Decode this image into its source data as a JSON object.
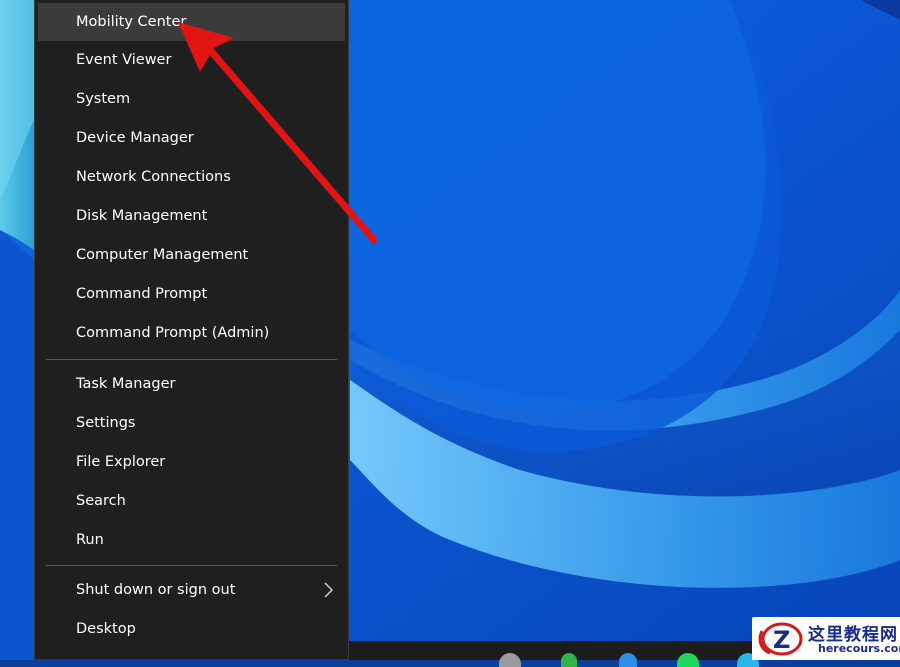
{
  "colors": {
    "menu_bg": "#1f1f1f",
    "menu_highlight": "#3b3b3b",
    "menu_text": "#ffffff",
    "separator": "#5a5a5a",
    "arrow": "#e11414",
    "desktop_blue": "#0a57d8"
  },
  "context_menu": {
    "group1": [
      {
        "label": "Mobility Center",
        "highlighted": true
      },
      {
        "label": "Event Viewer"
      },
      {
        "label": "System"
      },
      {
        "label": "Device Manager"
      },
      {
        "label": "Network Connections"
      },
      {
        "label": "Disk Management"
      },
      {
        "label": "Computer Management"
      },
      {
        "label": "Command Prompt"
      },
      {
        "label": "Command Prompt (Admin)"
      }
    ],
    "group2": [
      {
        "label": "Task Manager"
      },
      {
        "label": "Settings"
      },
      {
        "label": "File Explorer"
      },
      {
        "label": "Search"
      },
      {
        "label": "Run"
      }
    ],
    "group3": [
      {
        "label": "Shut down or sign out",
        "submenu_icon": "chevron-right-icon"
      },
      {
        "label": "Desktop"
      }
    ]
  },
  "watermark": {
    "title": "这里教程网",
    "site": "herecours.com"
  }
}
